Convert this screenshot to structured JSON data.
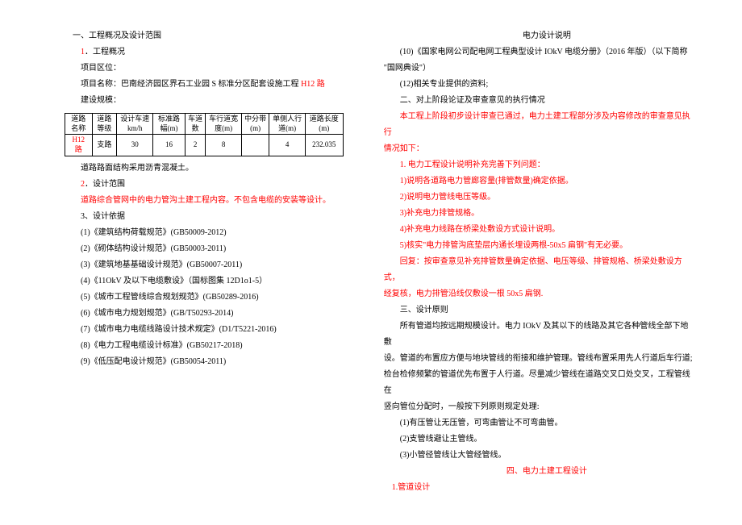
{
  "doc_title": "电力设计说明",
  "left": {
    "section1_title": "一、工程概况及设计范围",
    "sub1_num": "1",
    "sub1_title": "．工程概况",
    "project_loc": "项目区位：",
    "project_name_label": "项目名称：巴南经济园区界石工业园 S 标准分区配套设施工程 ",
    "project_name_road": "H12 路",
    "scale_label": "建设规模：",
    "table": {
      "headers": [
        "道路名称",
        "道路等级",
        "设计车速km/h",
        "标准路幅(m)",
        "车道数",
        "车行道宽度(m)",
        "中分带(m)",
        "单侧人行道(m)",
        "道路长度(m)"
      ],
      "row": [
        "H12 路",
        "支路",
        "30",
        "16",
        "2",
        "8",
        "",
        "4",
        "232.035"
      ]
    },
    "road_surface": "道路路面结构采用沥青混凝土。",
    "sub2_num": "2",
    "sub2_title": "．设计范围",
    "scope_desc": "道路综合管网中的电力管沟土建工程内容。不包含电缆的安装等设计。",
    "sub3_title": "3、设计依据",
    "refs": [
      "(1)《建筑结构荷载规范》(GB50009-2012)",
      "(2)《砌体结构设计规范》(GB50003-2011)",
      "(3)《建筑地基基础设计规范》(GB50007-2011)",
      "(4)《11OkV 及以下电缆敷设》（国标图集 12D1o1-5）",
      "(5)《城市工程管线综合规划规范》(GB50289-2016)",
      "(6)《城市电力规划规范》(GB/T50293-2014)",
      "(7)《城市电力电缆线路设计技术规定》(D1/T5221-2016)",
      "(8)《电力工程电缆设计标准》(GB50217-2018)",
      "(9)《低压配电设计规范》(GB50054-2011)"
    ]
  },
  "right": {
    "ref10": "(10)《国家电网公司配电网工程典型设计 IOkV 电缆分册》（2016 年版）（以下简称",
    "ref10_cont": "\"国网典设\"）",
    "ref12": "(12)相关专业提供的资料;",
    "section2_title": "二、对上阶段论证及审查意见的执行情况",
    "review_intro": "本工程上阶段初步设计审查已通过，电力土建工程部分涉及内容修改的审查意见执行",
    "review_intro2": "情况如下：",
    "review1": "1. 电力工程设计说明补充完善下列问题：",
    "review1_1": "1)说明各道路电力管廊容量(排管数量)确定依据。",
    "review1_2": "2)说明电力管线电压等级。",
    "review1_3": "3)补充电力排管规格。",
    "review1_4": "4)补充电力线路在桥梁处敷设方式设计说明。",
    "review1_5": "5)核实\"电力排管沟底垫层内通长埋设两根-50x5 扁钢\"有无必要。",
    "reply": "回复：按审查意见补充排管数量确定依据、电压等级、排管规格、桥梁处敷设方式，",
    "reply2": "经复核，电力排管沿线仅敷设一根 50x5 扁钢.",
    "section3_title": "三、设计原则",
    "principle1": "所有管道均按远期规模设计。电力 IOkV 及其以下的线路及其它各种管线全部下地敷",
    "principle2": "设。管道的布置应方便与地块管线的衔接和维护管理。管线布置采用先人行道后车行道;",
    "principle3": "检台检修频繁的管道优先布置于人行道。尽量减少管线在道路交叉口处交叉，工程管线在",
    "principle4": "竖向管位分配时，一般按下列原则规定处理:",
    "rule1": "(1)有压管让无压管，可弯曲管让不可弯曲管。",
    "rule2": "(2)支管线避让主管线。",
    "rule3": "(3)小管径管线让大管经管线。",
    "section4_title": "四、电力土建工程设计",
    "section4_sub": "1.管道设计"
  }
}
